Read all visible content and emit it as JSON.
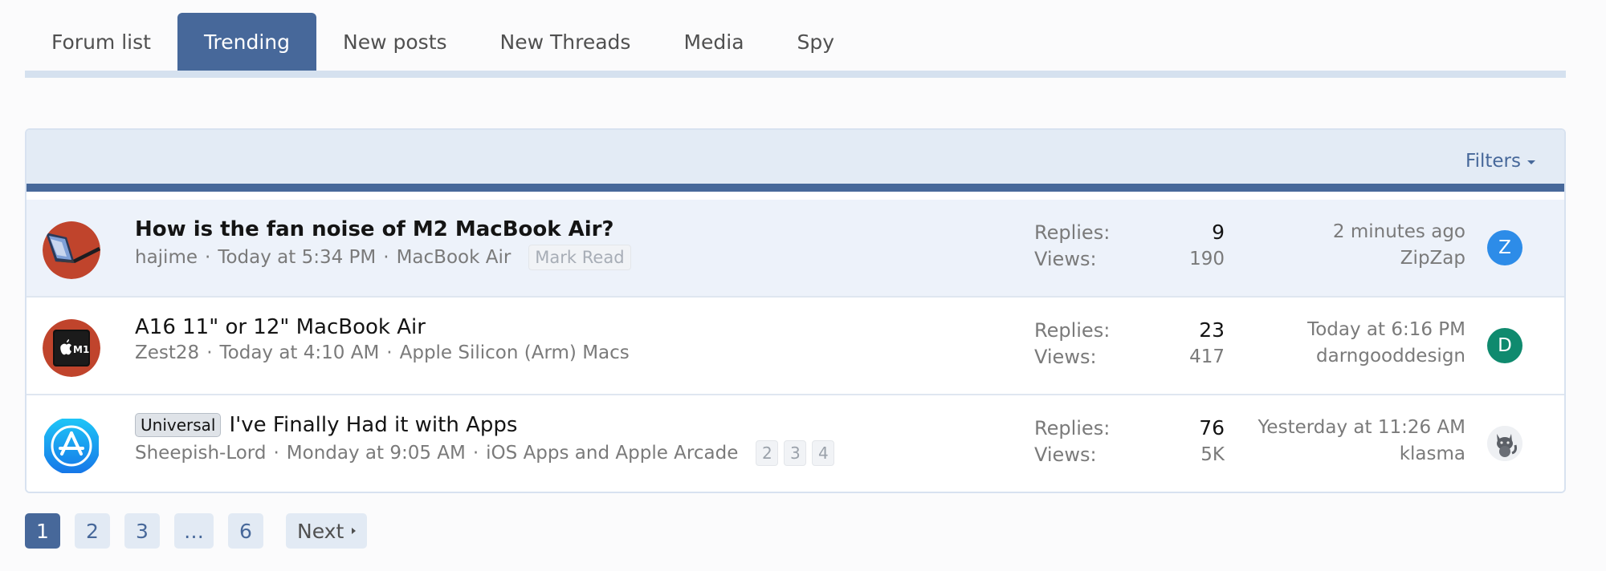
{
  "tabs": [
    {
      "label": "Forum list",
      "active": false
    },
    {
      "label": "Trending",
      "active": true
    },
    {
      "label": "New posts",
      "active": false
    },
    {
      "label": "New Threads",
      "active": false
    },
    {
      "label": "Media",
      "active": false
    },
    {
      "label": "Spy",
      "active": false
    }
  ],
  "block": {
    "filters_label": "Filters"
  },
  "labels": {
    "replies": "Replies:",
    "views": "Views:"
  },
  "threads": [
    {
      "title": "How is the fan noise of M2 MacBook Air?",
      "unread": true,
      "prefix": "",
      "author": "hajime",
      "date": "Today at 5:34 PM",
      "forum": "MacBook Air",
      "mark_read": "Mark Read",
      "pages": [],
      "replies": "9",
      "views": "190",
      "last_time": "2 minutes ago",
      "last_user": "ZipZap",
      "avatar_letter": "Z",
      "avatar_color": "#2d8ce8",
      "icon": "macbook-air-icon"
    },
    {
      "title": "A16 11\" or 12\" MacBook Air",
      "unread": false,
      "prefix": "",
      "author": "Zest28",
      "date": "Today at 4:10 AM",
      "forum": "Apple Silicon (Arm) Macs",
      "mark_read": "",
      "pages": [],
      "replies": "23",
      "views": "417",
      "last_time": "Today at 6:16 PM",
      "last_user": "darngooddesign",
      "avatar_letter": "D",
      "avatar_color": "#0f8a6e",
      "icon": "apple-m1-chip-icon",
      "icon_text": "M1"
    },
    {
      "title": "I've Finally Had it with Apps",
      "unread": false,
      "prefix": "Universal",
      "author": "Sheepish-Lord",
      "date": "Monday at 9:05 AM",
      "forum": "iOS Apps and Apple Arcade",
      "mark_read": "",
      "pages": [
        "2",
        "3",
        "4"
      ],
      "replies": "76",
      "views": "5K",
      "last_time": "Yesterday at 11:26 AM",
      "last_user": "klasma",
      "avatar_letter": "",
      "avatar_color": "#e8eaee",
      "icon": "app-store-icon"
    }
  ],
  "pagination": {
    "pages": [
      "1",
      "2",
      "3",
      "…",
      "6"
    ],
    "current": "1",
    "next_label": "Next"
  },
  "colors": {
    "accent": "#47689a",
    "tab_underline": "#d5e1ef",
    "header_bg": "#e3ebf5",
    "unread_row_bg": "#edf2fa"
  }
}
